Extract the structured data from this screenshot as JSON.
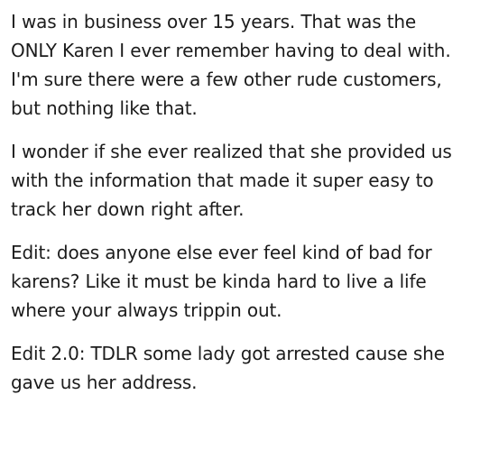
{
  "post": {
    "paragraphs": [
      {
        "lines": [
          "I was in business over 15 years. That was the",
          "ONLY Karen I ever remember having to deal with.",
          "I'm sure there were a few other rude customers,",
          "but nothing like that."
        ]
      },
      {
        "lines": [
          "I wonder if she ever realized that she provided us",
          "with the information that made it super easy to",
          "track her down right after."
        ]
      },
      {
        "lines": [
          "Edit: does anyone else ever feel kind of bad for",
          "karens? Like it must be kinda hard to live a life",
          "where your always trippin out."
        ]
      },
      {
        "lines": [
          "Edit 2.0: TDLR some lady got arrested cause she",
          "gave us her address."
        ]
      }
    ]
  }
}
